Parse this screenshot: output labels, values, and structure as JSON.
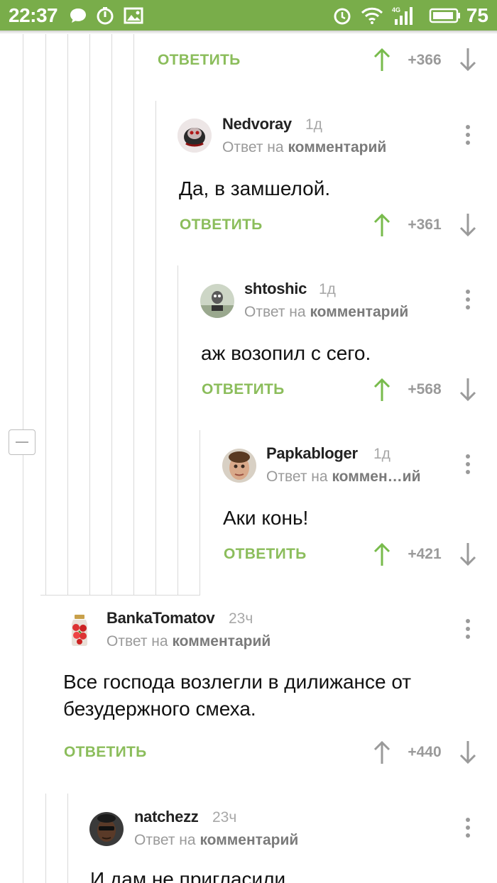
{
  "status_bar": {
    "time": "22:37",
    "battery": "75",
    "network": "4G",
    "icons": [
      "chat-bubble-icon",
      "timer-icon",
      "image-icon",
      "alarm-icon",
      "wifi-icon",
      "signal-icon",
      "battery-icon"
    ],
    "color": "#79ad4a"
  },
  "colors": {
    "accent_green": "#8bbd5b",
    "upvote_green": "#78bb4c",
    "muted_gray": "#9a9a9a"
  },
  "top_action": {
    "reply_label": "ОТВЕТИТЬ",
    "score": "+366"
  },
  "comments": [
    {
      "author": "Nedvoray",
      "age": "1д",
      "reply_prefix": "Ответ на",
      "reply_target": "комментарий",
      "text": "Да, в замшелой.",
      "reply_label": "ОТВЕТИТЬ",
      "score": "+361",
      "upvoted": true
    },
    {
      "author": "shtoshic",
      "age": "1д",
      "reply_prefix": "Ответ на",
      "reply_target": "комментарий",
      "text": "аж возопил с сего.",
      "reply_label": "ОТВЕТИТЬ",
      "score": "+568",
      "upvoted": true
    },
    {
      "author": "Papkabloger",
      "age": "1д",
      "reply_prefix": "Ответ на",
      "reply_target": "коммен…ий",
      "text": "Аки конь!",
      "reply_label": "ОТВЕТИТЬ",
      "score": "+421",
      "upvoted": true
    },
    {
      "author": "BankaTomatov",
      "age": "23ч",
      "reply_prefix": "Ответ на",
      "reply_target": "комментарий",
      "text": "Все господа возлегли в дилижансе от безудержного смеха.",
      "reply_label": "ОТВЕТИТЬ",
      "score": "+440",
      "upvoted": false
    },
    {
      "author": "natchezz",
      "age": "23ч",
      "reply_prefix": "Ответ на",
      "reply_target": "комментарий",
      "text": "И дам не пригласили...",
      "reply_label": "",
      "score": "",
      "upvoted": false
    }
  ]
}
